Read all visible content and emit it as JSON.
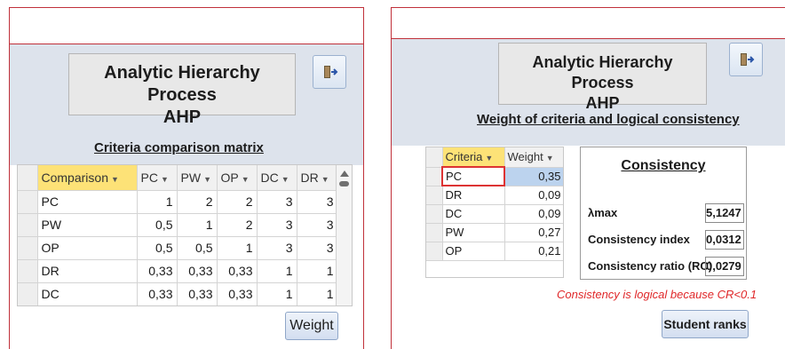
{
  "left_panel": {
    "title_line1": "Analytic Hierarchy Process",
    "title_line2": "AHP",
    "subtitle": "Criteria comparison matrix",
    "exit_icon": "exit-door-icon",
    "table": {
      "headers": [
        "Comparison",
        "PC",
        "PW",
        "OP",
        "DC",
        "DR"
      ],
      "rows": [
        [
          "PC",
          "1",
          "2",
          "2",
          "3",
          "3"
        ],
        [
          "PW",
          "0,5",
          "1",
          "2",
          "3",
          "3"
        ],
        [
          "OP",
          "0,5",
          "0,5",
          "1",
          "3",
          "3"
        ],
        [
          "DR",
          "0,33",
          "0,33",
          "0,33",
          "1",
          "1"
        ],
        [
          "DC",
          "0,33",
          "0,33",
          "0,33",
          "1",
          "1"
        ]
      ]
    },
    "weight_button": "Weight"
  },
  "right_panel": {
    "title_line1": "Analytic Hierarchy Process",
    "title_line2": "AHP",
    "subtitle": "Weight of criteria and logical consistency",
    "exit_icon": "exit-door-icon",
    "table": {
      "headers": [
        "Criteria",
        "Weight"
      ],
      "rows": [
        [
          "PC",
          "0,35"
        ],
        [
          "DR",
          "0,09"
        ],
        [
          "DC",
          "0,09"
        ],
        [
          "PW",
          "0,27"
        ],
        [
          "OP",
          "0,21"
        ]
      ]
    },
    "consistency": {
      "title": "Consistency",
      "lambda_label": "λmax",
      "lambda_value": "5,1247",
      "index_label": "Consistency index",
      "index_value": "0,0312",
      "ratio_label": "Consistency ratio (RC)",
      "ratio_value": "0,0279"
    },
    "note": "Consistency is logical because CR<0.1",
    "ranks_button": "Student ranks"
  },
  "colors": {
    "header_band": "#dde3ec",
    "active_column": "#fde277",
    "note_red": "#e0282a"
  }
}
